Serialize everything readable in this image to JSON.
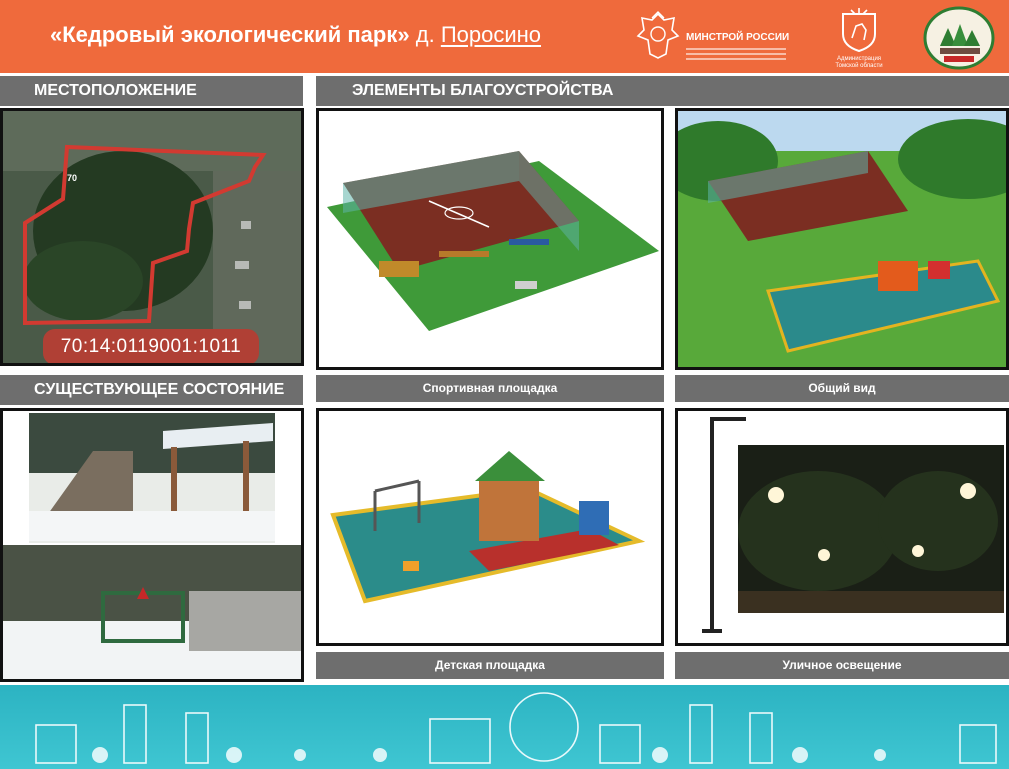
{
  "header": {
    "title_bold": "«Кедровый экологический парк»",
    "title_prefix": "д.",
    "title_place": "Поросино",
    "ministry_title": "МИНСТРОЙ РОССИИ",
    "admin_caption_line1": "Администрация",
    "admin_caption_line2": "Томской области"
  },
  "sections": {
    "location": "МЕСТОПОЛОЖЕНИЕ",
    "elements": "ЭЛЕМЕНТЫ БЛАГОУСТРОЙСТВА",
    "current_state": "СУЩЕСТВУЮЩЕЕ СОСТОЯНИЕ"
  },
  "map": {
    "cadastral_number": "70:14:0119001:1011",
    "marker_label": "70"
  },
  "captions": {
    "sports": "Спортивная площадка",
    "overview": "Общий вид",
    "kids": "Детская площадка",
    "lighting": "Уличное освещение"
  },
  "colors": {
    "header_bg": "#ef6a3c",
    "label_bg": "#6e6e6e",
    "footer_bg": "#36bdc9"
  }
}
